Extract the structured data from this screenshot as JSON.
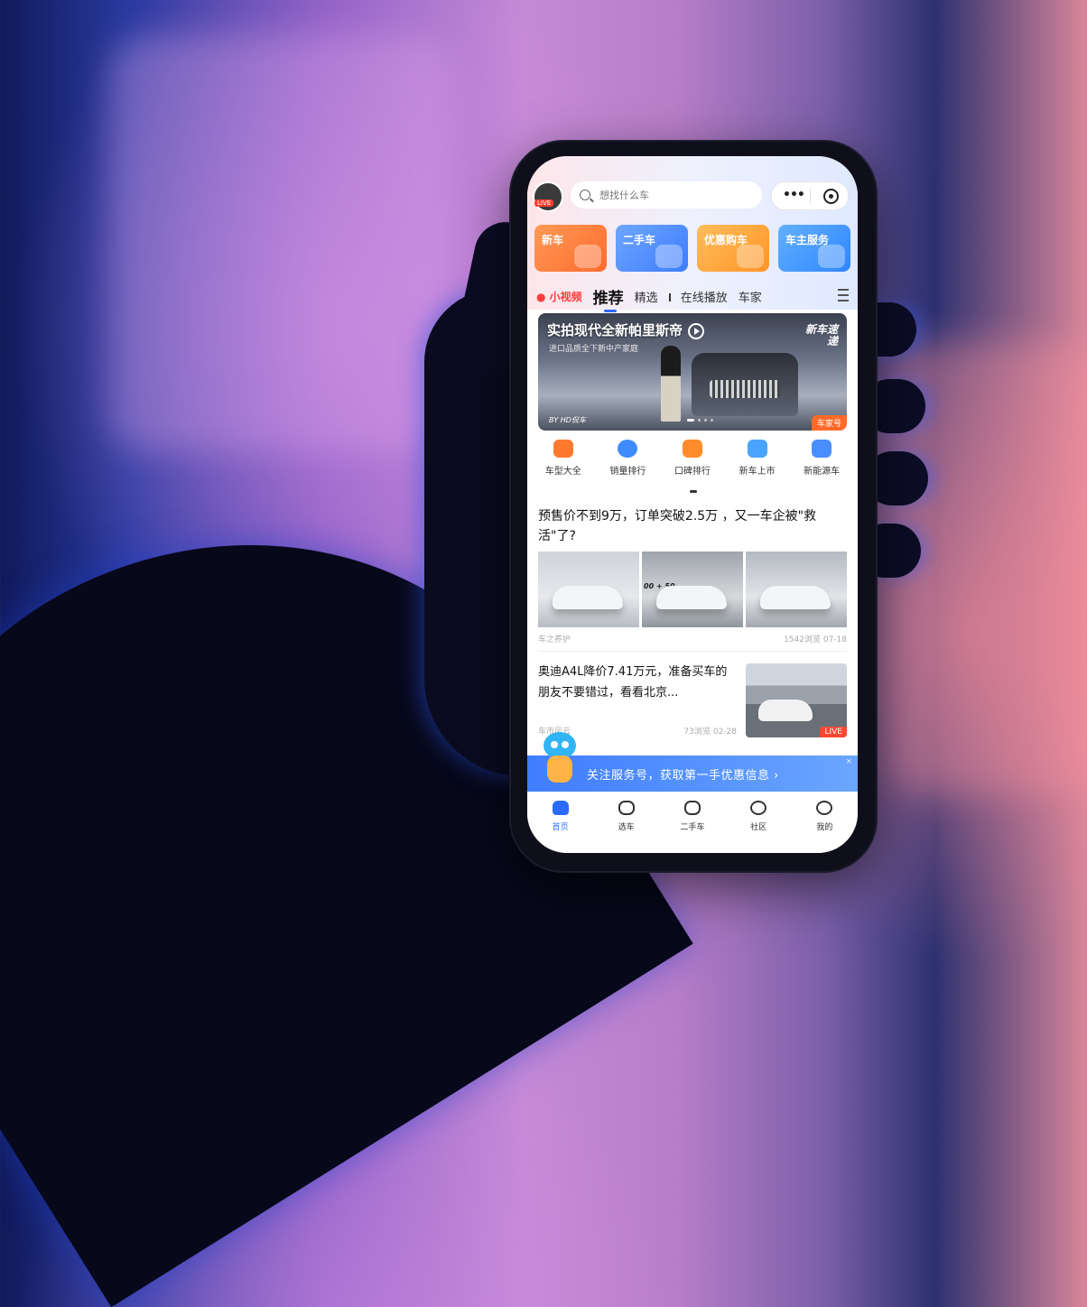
{
  "header": {
    "avatar_live": "LIVE",
    "search_placeholder": "想找什么车",
    "more_icon": "more-dots-icon",
    "target_icon": "record-target-icon"
  },
  "categories": [
    {
      "label": "新车",
      "color": "#ff7a3a"
    },
    {
      "label": "二手车",
      "color": "#4f8dff"
    },
    {
      "label": "优惠购车",
      "color": "#ffa236"
    },
    {
      "label": "车主服务",
      "color": "#3f95ff"
    }
  ],
  "tabs": {
    "video": "小视频",
    "active": "推荐",
    "items": [
      "精选",
      "在线播放",
      "车家"
    ]
  },
  "banner": {
    "title": "实拍现代全新帕里斯帝",
    "subtitle": "进口品质全下新中产家庭",
    "badge": "新车速递",
    "by": "BY HD侃车",
    "channel": "车家号"
  },
  "quick_links": [
    {
      "label": "车型大全",
      "color": "#ff7a2e"
    },
    {
      "label": "销量排行",
      "color": "#3d8bff"
    },
    {
      "label": "口碑排行",
      "color": "#ff8c2a"
    },
    {
      "label": "新车上市",
      "color": "#4aa3ff"
    },
    {
      "label": "新能源车",
      "color": "#4a8dff"
    }
  ],
  "article1": {
    "title": "预售价不到9万，订单突破2.5万 ，又一车企被\"救活\"了?",
    "source": "车之养护",
    "stats": "1542浏览 07-18",
    "image_tag": "00 + 50"
  },
  "article2": {
    "title": "奥迪A4L降价7.41万元，准备买车的朋友不要错过，看看北京...",
    "source": "车市风云",
    "stats": "73浏览 02-28",
    "live": "LIVE"
  },
  "follow_bar": {
    "text": "关注服务号，获取第一手优惠信息 ›",
    "close": "×"
  },
  "bottom_nav": [
    {
      "label": "首页",
      "active": true
    },
    {
      "label": "选车",
      "active": false
    },
    {
      "label": "二手车",
      "active": false
    },
    {
      "label": "社区",
      "active": false
    },
    {
      "label": "我的",
      "active": false
    }
  ]
}
